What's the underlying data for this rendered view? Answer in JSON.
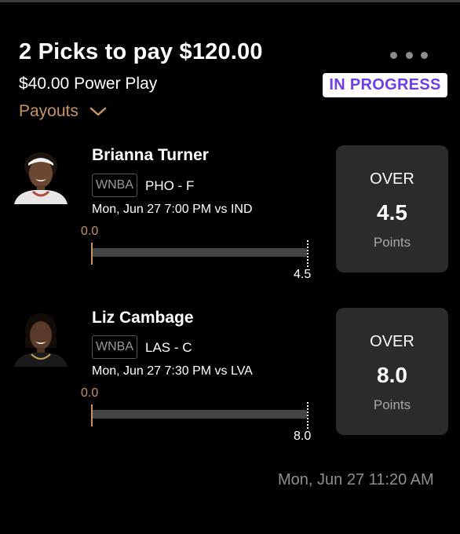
{
  "entry": {
    "title": "2 Picks to pay $120.00",
    "subtitle": "$40.00 Power Play",
    "status": "IN PROGRESS",
    "payouts_label": "Payouts",
    "timestamp": "Mon, Jun 27 11:20 AM"
  },
  "picks": [
    {
      "player": "Brianna Turner",
      "league": "WNBA",
      "team_pos": "PHO - F",
      "game": "Mon, Jun 27 7:00 PM  vs IND",
      "current": "0.0",
      "progress": 0,
      "target": "4.5",
      "direction": "OVER",
      "line": "4.5",
      "stat": "Points"
    },
    {
      "player": "Liz Cambage",
      "league": "WNBA",
      "team_pos": "LAS - C",
      "game": "Mon, Jun 27 7:30 PM  vs LVA",
      "current": "0.0",
      "progress": 0,
      "target": "8.0",
      "direction": "OVER",
      "line": "8.0",
      "stat": "Points"
    }
  ],
  "colors": {
    "background": "#000000",
    "accent_orange": "#c8935e",
    "status_purple": "#6f3ee8",
    "card_bg": "#2b2b2b"
  },
  "icons": [
    "more-dots-icon",
    "chevron-down-icon"
  ]
}
